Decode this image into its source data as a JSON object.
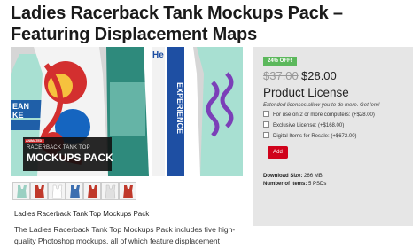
{
  "page": {
    "title": "Ladies Racerback Tank Mockups Pack – Featuring Displacement Maps"
  },
  "hero": {
    "tag_text": "ANIMATED",
    "overlay_line1": "RACERBACK TANK TOP",
    "overlay_line2": "MOCKUPS PACK",
    "left_shirt_text": "EAN\nKE",
    "mid_shirt_text": "CLEVELAND\nEXPERIENCE",
    "small_text": "He"
  },
  "thumbnails": [
    {
      "icon": "tank-top-thumbnail-icon",
      "color": "#9ad0c2"
    },
    {
      "icon": "tank-top-thumbnail-icon",
      "color": "#c0392b"
    },
    {
      "icon": "tank-top-thumbnail-icon",
      "color": "#f0f0f0"
    },
    {
      "icon": "tank-top-thumbnail-icon",
      "color": "#3d6fb0"
    },
    {
      "icon": "tank-top-thumbnail-icon",
      "color": "#c0392b"
    },
    {
      "icon": "tank-top-thumbnail-icon",
      "color": "#e0e0e0"
    },
    {
      "icon": "tank-top-thumbnail-icon",
      "color": "#c0392b"
    }
  ],
  "description": {
    "title": "Ladies Racerback Tank Top Mockups Pack",
    "body": "The Ladies Racerback Tank Top Mockups Pack includes five high-quality Photoshop mockups, all of which feature displacement"
  },
  "pricing": {
    "discount_badge": "24% OFF!",
    "old_price": "$37.00",
    "new_price": "$28.00",
    "license_title": "Product License",
    "license_note": "Extended licenses allow you to do more. Get 'em!",
    "options": [
      {
        "label": "For use on 2 or more computers: (+$28.00)",
        "checked": false
      },
      {
        "label": "Exclusive License: (+$168.00)",
        "checked": false
      },
      {
        "label": "Digital Items for Resale: (+$672.00)",
        "checked": false
      }
    ],
    "add_button": "Add",
    "download_size_label": "Download Size:",
    "download_size_value": "266 MB",
    "num_items_label": "Number of Items:",
    "num_items_value": "5 PSDs"
  },
  "colors": {
    "badge": "#5cb85c",
    "add_button": "#d0021b",
    "panel_bg": "#e6e6e6"
  }
}
